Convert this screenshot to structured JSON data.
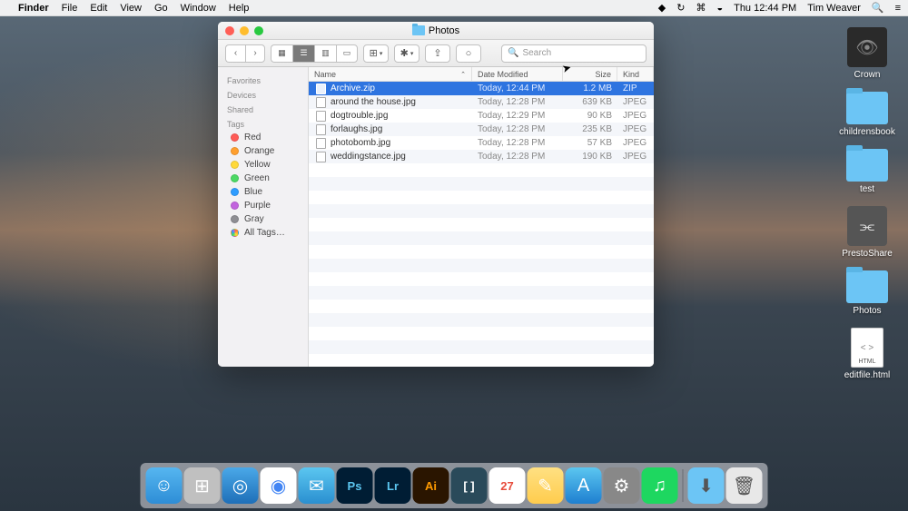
{
  "menubar": {
    "app": "Finder",
    "items": [
      "File",
      "Edit",
      "View",
      "Go",
      "Window",
      "Help"
    ],
    "clock": "Thu 12:44 PM",
    "user": "Tim Weaver"
  },
  "desktop_items": [
    {
      "type": "crown",
      "label": "Crown"
    },
    {
      "type": "folder",
      "label": "childrensbook"
    },
    {
      "type": "folder",
      "label": "test"
    },
    {
      "type": "shared",
      "label": "PrestoShare"
    },
    {
      "type": "folder",
      "label": "Photos"
    },
    {
      "type": "html",
      "label": "editfile.html",
      "badge": "HTML"
    }
  ],
  "finder": {
    "title": "Photos",
    "search_placeholder": "Search",
    "sidebar": {
      "sections": [
        "Favorites",
        "Devices",
        "Shared",
        "Tags"
      ],
      "tags": [
        {
          "name": "Red",
          "color": "#ff5b56"
        },
        {
          "name": "Orange",
          "color": "#ff9f2e"
        },
        {
          "name": "Yellow",
          "color": "#ffd93a"
        },
        {
          "name": "Green",
          "color": "#4cd964"
        },
        {
          "name": "Blue",
          "color": "#2e9cff"
        },
        {
          "name": "Purple",
          "color": "#c264de"
        },
        {
          "name": "Gray",
          "color": "#8e8e93"
        }
      ],
      "all_tags": "All Tags…"
    },
    "columns": {
      "name": "Name",
      "modified": "Date Modified",
      "size": "Size",
      "kind": "Kind"
    },
    "files": [
      {
        "name": "Archive.zip",
        "modified": "Today, 12:44 PM",
        "size": "1.2 MB",
        "kind": "ZIP",
        "selected": true
      },
      {
        "name": "around the house.jpg",
        "modified": "Today, 12:28 PM",
        "size": "639 KB",
        "kind": "JPEG"
      },
      {
        "name": "dogtrouble.jpg",
        "modified": "Today, 12:29 PM",
        "size": "90 KB",
        "kind": "JPEG"
      },
      {
        "name": "forlaughs.jpg",
        "modified": "Today, 12:28 PM",
        "size": "235 KB",
        "kind": "JPEG"
      },
      {
        "name": "photobomb.jpg",
        "modified": "Today, 12:28 PM",
        "size": "57 KB",
        "kind": "JPEG"
      },
      {
        "name": "weddingstance.jpg",
        "modified": "Today, 12:28 PM",
        "size": "190 KB",
        "kind": "JPEG"
      }
    ]
  },
  "dock": [
    {
      "name": "finder",
      "bg": "linear-gradient(#56b6f0,#2e8dd6)",
      "glyph": "☺"
    },
    {
      "name": "launchpad",
      "bg": "#c0c0c0",
      "glyph": "⊞"
    },
    {
      "name": "safari",
      "bg": "linear-gradient(#4aa8e8,#1e6fb8)",
      "glyph": "◎"
    },
    {
      "name": "chrome",
      "bg": "#fff",
      "glyph": "◉"
    },
    {
      "name": "mail",
      "bg": "linear-gradient(#5bc6f0,#2a8fd0)",
      "glyph": "✉"
    },
    {
      "name": "photoshop",
      "bg": "#001d34",
      "glyph": "Ps"
    },
    {
      "name": "lightroom",
      "bg": "#001d34",
      "glyph": "Lr"
    },
    {
      "name": "illustrator",
      "bg": "#2a1500",
      "glyph": "Ai"
    },
    {
      "name": "brackets",
      "bg": "#2a4a5a",
      "glyph": "[ ]"
    },
    {
      "name": "calendar",
      "bg": "#fff",
      "glyph": "27"
    },
    {
      "name": "notes",
      "bg": "linear-gradient(#ffe082,#ffcc4d)",
      "glyph": "✎"
    },
    {
      "name": "appstore",
      "bg": "linear-gradient(#5bc6f0,#1e7fd0)",
      "glyph": "A"
    },
    {
      "name": "settings",
      "bg": "#888",
      "glyph": "⚙"
    },
    {
      "name": "spotify",
      "bg": "#1ed760",
      "glyph": "♫"
    }
  ],
  "dock_right": [
    {
      "name": "downloads",
      "bg": "#6cc5f5",
      "glyph": "⬇"
    },
    {
      "name": "trash",
      "bg": "#e8e8e8",
      "glyph": "🗑"
    }
  ]
}
